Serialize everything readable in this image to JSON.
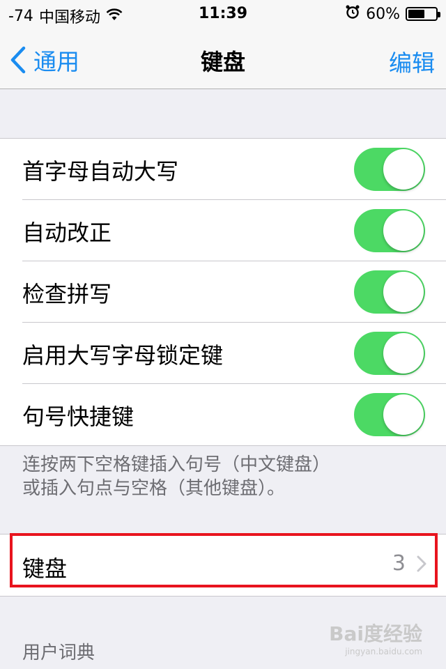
{
  "status_bar": {
    "signal": "-74",
    "carrier": "中国移动",
    "time": "11:39",
    "battery": "60%",
    "battery_level": 0.6
  },
  "nav": {
    "back_label": "通用",
    "title": "键盘",
    "edit_label": "编辑"
  },
  "toggles": [
    {
      "label": "首字母自动大写",
      "on": true
    },
    {
      "label": "自动改正",
      "on": true
    },
    {
      "label": "检查拼写",
      "on": true
    },
    {
      "label": "启用大写字母锁定键",
      "on": true
    },
    {
      "label": "句号快捷键",
      "on": true
    }
  ],
  "note": {
    "line1": "连按两下空格键插入句号（中文键盘）",
    "line2": "或插入句点与空格（其他键盘）。"
  },
  "keyboards": {
    "label": "键盘",
    "count": "3"
  },
  "user_dict": {
    "header": "用户词典"
  },
  "watermark": {
    "text": "Bai度经验",
    "sub": "jingyan.baidu.com"
  },
  "colors": {
    "accent": "#1a8cf0",
    "toggle_on": "#4cd964",
    "highlight": "#e8141e"
  }
}
